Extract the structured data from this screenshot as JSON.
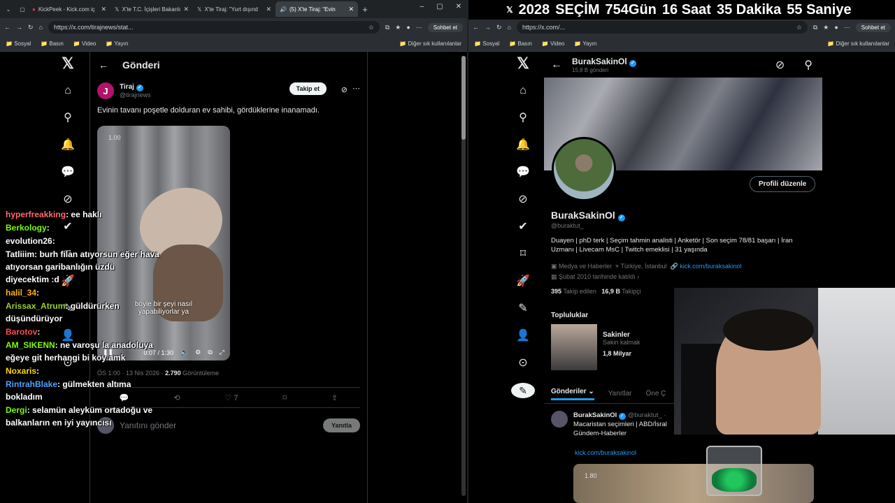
{
  "left_browser": {
    "tabs": [
      {
        "label": "KickPeek - Kick.com iç",
        "icon": "kick-icon"
      },
      {
        "label": "X'te T.C. İçişleri Bakanlı",
        "icon": "x-icon"
      },
      {
        "label": "X'te Tiraj: \"Yurt dışınd",
        "icon": "x-icon"
      },
      {
        "label": "(5) X'te Tiraj: \"Evin",
        "icon": "x-icon"
      }
    ],
    "url": "https://x.com/tirajnews/stat...",
    "chat_button": "Sohbet et",
    "bookmarks": [
      "Sosyal",
      "Basın",
      "Video",
      "Yayın"
    ],
    "bookmarks_other": "Diğer sık kullanılanlar"
  },
  "right_browser": {
    "url": "https://x.com/...",
    "chat_button": "Sohbet et",
    "bookmarks": [
      "Sosyal",
      "Basın",
      "Video",
      "Yayın"
    ],
    "bookmarks_other": "Diğer sık kullanılanlar"
  },
  "countdown": {
    "year": "2028",
    "label": "SEÇİM",
    "days": "754",
    "days_unit": "Gün",
    "hours": "16",
    "hours_unit": "Saat",
    "minutes": "35",
    "minutes_unit": "Dakika",
    "seconds": "55",
    "seconds_unit": "Saniye"
  },
  "post": {
    "header_title": "Gönderi",
    "author_name": "Tiraj",
    "author_handle": "@tirajnews",
    "avatar_letter": "J",
    "follow_label": "Takip et",
    "text": "Evinin tavanı poşetle dolduran ev sahibi, gördüklerine inanamadı.",
    "video_badge": "1.00",
    "video_caption_1": "böyle bir şeyi nasıl",
    "video_caption_2": "yapabiliyorlar ya",
    "video_time": "0:07 / 1:30",
    "meta_time": "ÖS 1:00 · 13 Nis 2026 ·",
    "views": "2.790",
    "views_label": "Görüntüleme",
    "likes": "7",
    "reply_placeholder": "Yanıtını gönder",
    "reply_button": "Yanıtla"
  },
  "chat": [
    {
      "user": "hyperfreakking",
      "color": "#ff6b6b",
      "msg": "ee haklı"
    },
    {
      "user": "Berkology",
      "color": "#7CFC00",
      "msg": ""
    },
    {
      "user": "evolution26",
      "color": "#ffffff",
      "msg": ""
    },
    {
      "user": "Tatliiim",
      "color": "#ffffff",
      "msg": "burh filan atıyorsun eğer hava atıyorsan garibanlığın üzdü diyecektim :d"
    },
    {
      "user": "halil_34",
      "color": "#ffb300",
      "msg": ""
    },
    {
      "user": "Arissax_Atrum",
      "color": "#9acd32",
      "msg": "güldürürken düşündürüyor"
    },
    {
      "user": "Barotov",
      "color": "#ff4d4d",
      "msg": ""
    },
    {
      "user": "AM_SIKENN",
      "color": "#7CFC00",
      "msg": "ne varoşu la anadoluya eğeye git herhangi bi köy amk"
    },
    {
      "user": "Noxaris",
      "color": "#ffd700",
      "msg": ""
    },
    {
      "user": "RintrahBlake",
      "color": "#4ea1ff",
      "msg": "gülmekten altıma bokladım"
    },
    {
      "user": "Dergi",
      "color": "#7CFC00",
      "msg": "selamün aleyküm ortadoğu ve balkanların en iyi yayıncısı"
    }
  ],
  "profile": {
    "header_name": "BurakSakinOl",
    "posts_count": "15,8 B gönderi",
    "edit_button": "Profili düzenle",
    "name": "BurakSakinOl",
    "handle": "@buraktut_",
    "bio": "Duayen | phD terk | Seçim tahmin analisti | Anketör | Son seçim 78/81 başarı | İran Uzmanı | Livecam MsC | Twitch emeklisi | 31 yaşında",
    "category": "Medya ve Haberler",
    "location": "Türkiye, İstanbul",
    "link": "kick.com/buraksakinol",
    "joined": "Şubat 2010 tarihinde katıldı",
    "following": "395",
    "following_label": "Takip edilen",
    "followers": "16,9 B",
    "followers_label": "Takipçi",
    "communities_title": "Topluluklar",
    "community_name": "Sakinler",
    "community_desc": "Sakin kalmak",
    "community_members": "1,8 Milyar",
    "tabs": [
      "Gönderiler",
      "Yanıtlar",
      "Öne Ç"
    ],
    "post_author": "BurakSakinOl",
    "post_handle": "@buraktut_ ·",
    "post_text": "Macaristan seçimleri | ABD/İsral Gündem-Haberler",
    "post_link": "kick.com/buraksakinol",
    "post_badge": "1.80"
  }
}
